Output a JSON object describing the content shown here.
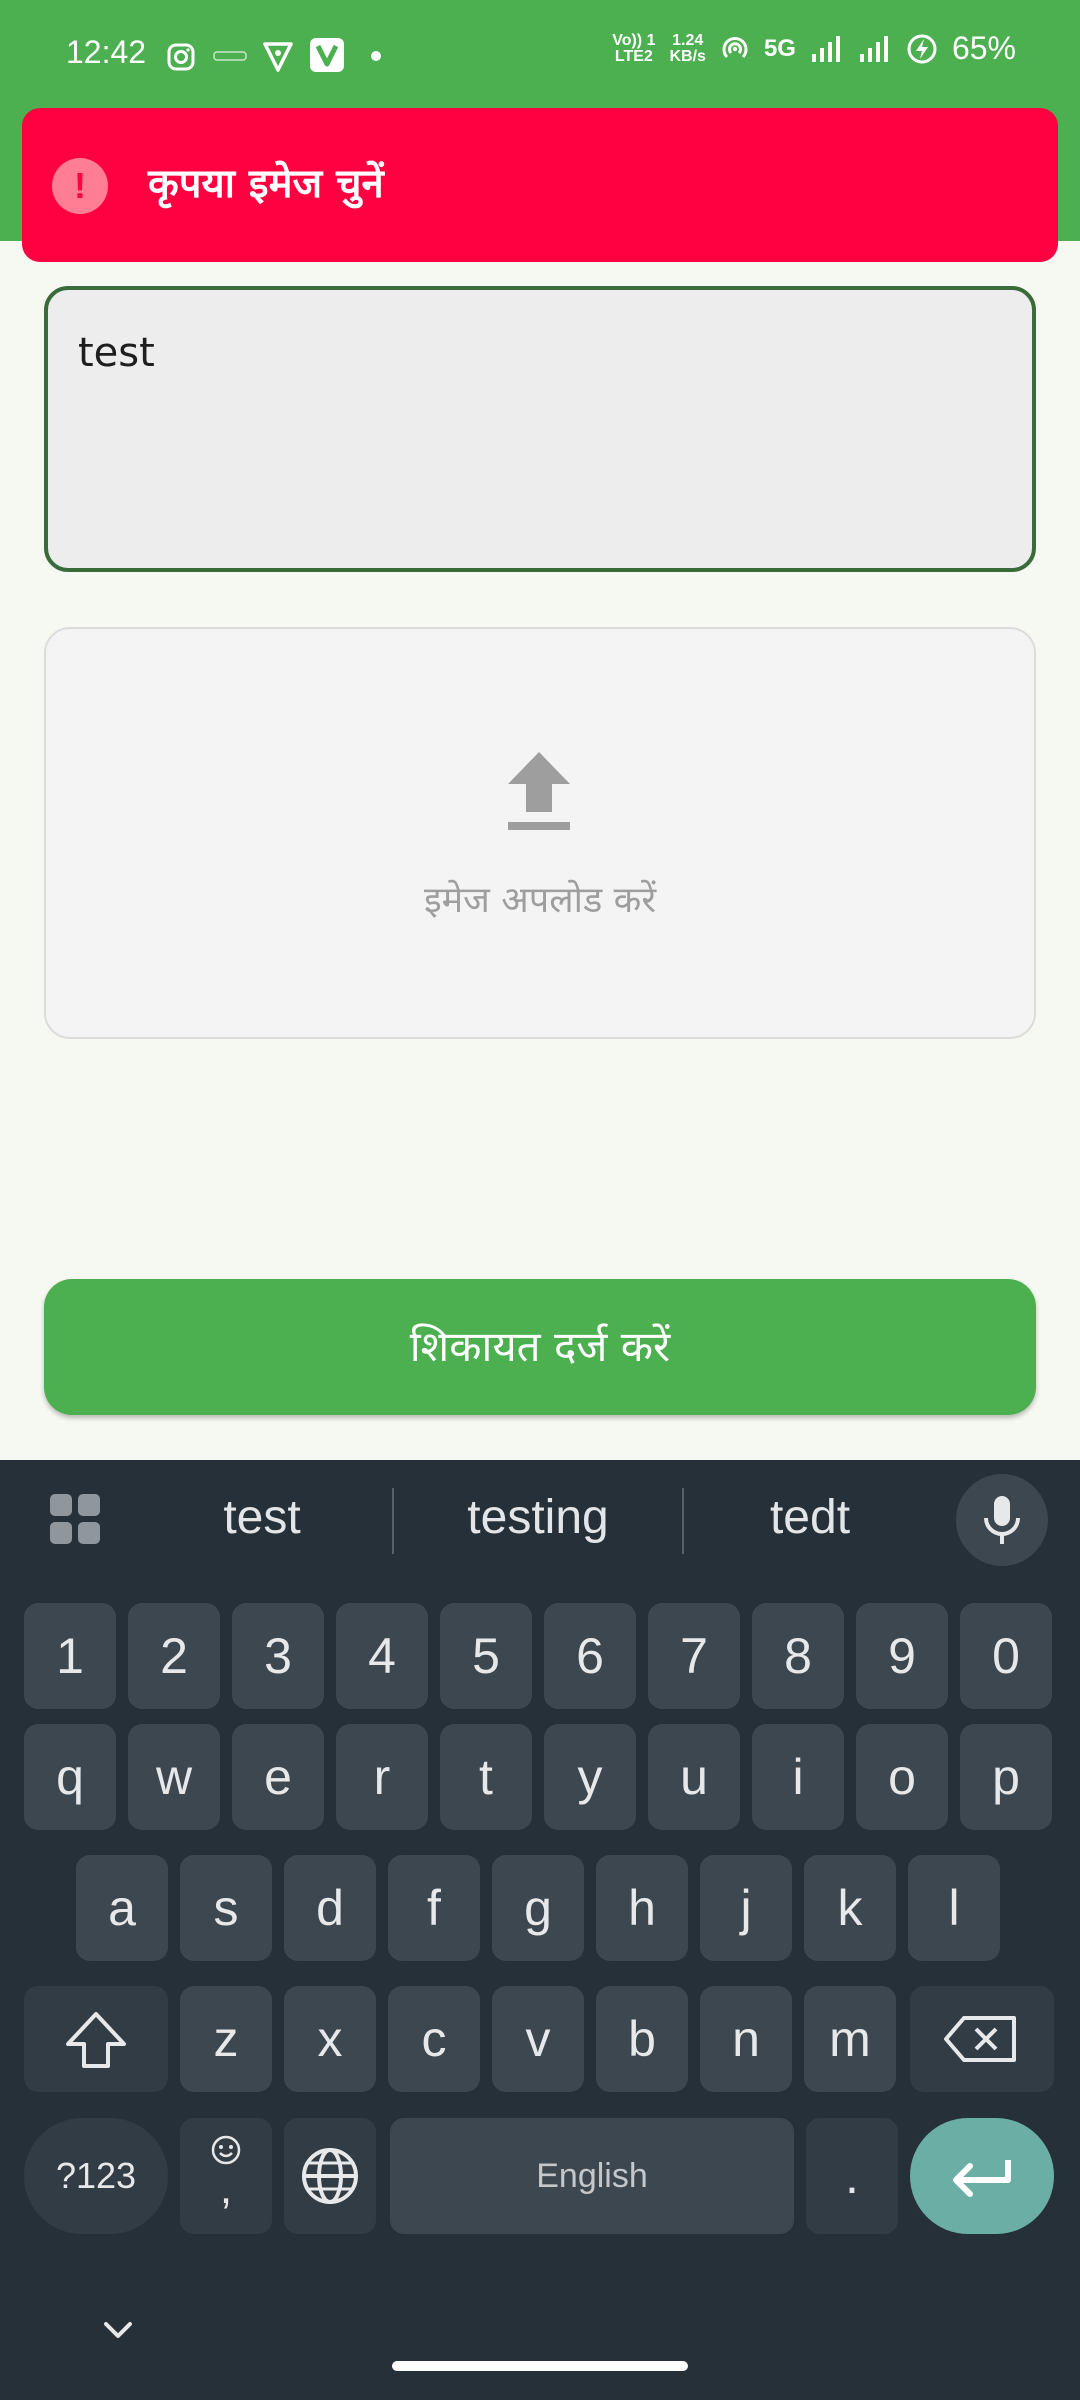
{
  "status_bar": {
    "time": "12:42",
    "volte_top": "Vo)) 1",
    "volte_bottom": "LTE2",
    "speed_top": "1.24",
    "speed_bottom": "KB/s",
    "network": "5G",
    "battery": "65%"
  },
  "banner": {
    "icon_glyph": "!",
    "message": "कृपया इमेज चुनें",
    "color": "#ff0040"
  },
  "form": {
    "text_value": "test",
    "upload_label": "इमेज अपलोड करें",
    "submit_label": "शिकायत दर्ज करें",
    "accent_color": "#4caf50"
  },
  "keyboard": {
    "suggestions": [
      "test",
      "testing",
      "tedt"
    ],
    "number_row": [
      "1",
      "2",
      "3",
      "4",
      "5",
      "6",
      "7",
      "8",
      "9",
      "0"
    ],
    "row1": [
      "q",
      "w",
      "e",
      "r",
      "t",
      "y",
      "u",
      "i",
      "o",
      "p"
    ],
    "row2": [
      "a",
      "s",
      "d",
      "f",
      "g",
      "h",
      "j",
      "k",
      "l"
    ],
    "row3": [
      "z",
      "x",
      "c",
      "v",
      "b",
      "n",
      "m"
    ],
    "symbols_label": "?123",
    "comma_label": ",",
    "space_label": "English",
    "period_label": "."
  }
}
